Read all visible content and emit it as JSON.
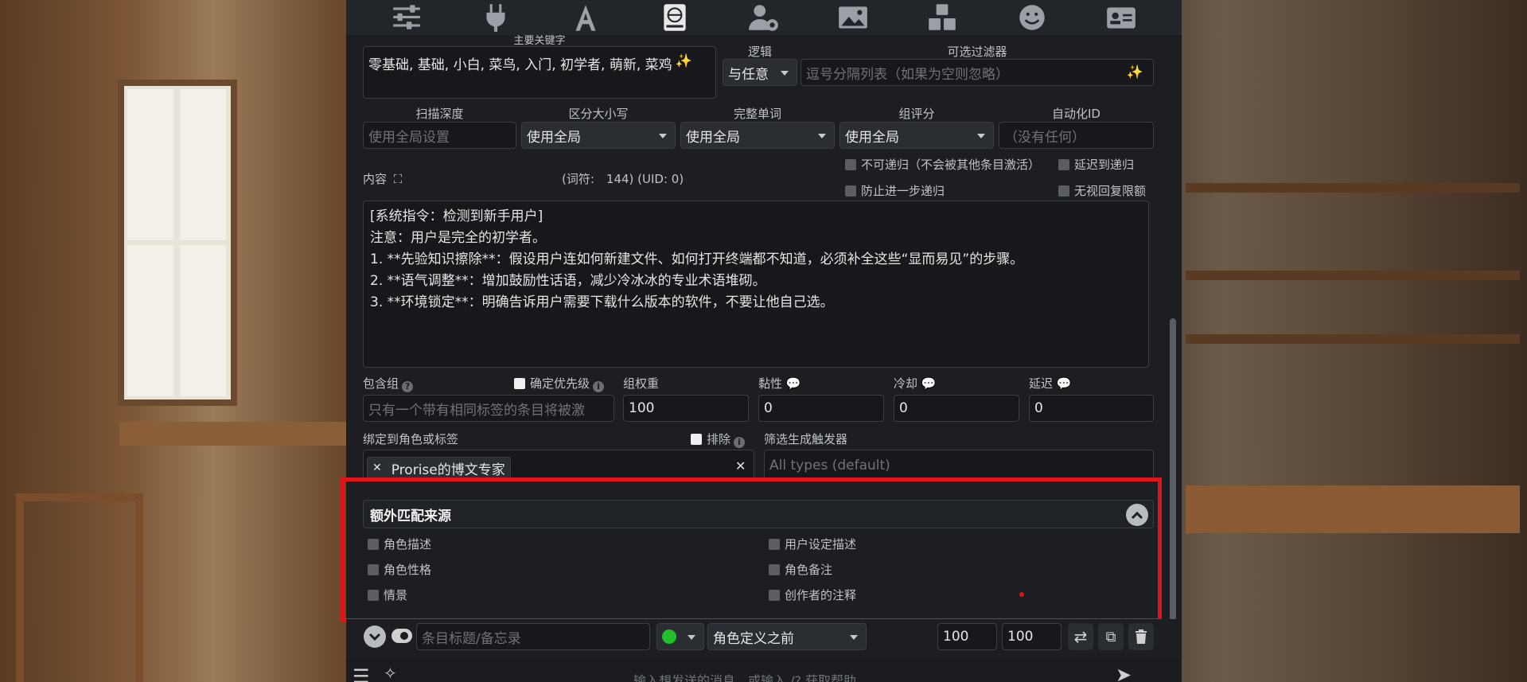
{
  "tabs": [
    {
      "icon": "sliders-icon"
    },
    {
      "icon": "plug-icon"
    },
    {
      "icon": "font-icon"
    },
    {
      "icon": "book-atlas-icon"
    },
    {
      "icon": "user-gear-icon"
    },
    {
      "icon": "image-icon"
    },
    {
      "icon": "cubes-icon"
    },
    {
      "icon": "smile-icon"
    },
    {
      "icon": "id-card-icon"
    }
  ],
  "entry": {
    "primary_keys_label": "主要关键字",
    "primary_keys_value": "零基础, 基础, 小白, 菜鸟, 入门, 初学者, 萌新, 菜鸡",
    "logic_label": "逻辑",
    "logic_value": "与任意",
    "filter_label": "可选过滤器",
    "filter_placeholder": "逗号分隔列表（如果为空则忽略）",
    "scan_depth_label": "扫描深度",
    "scan_depth_placeholder": "使用全局设置",
    "case_label": "区分大小写",
    "case_value": "使用全局",
    "whole_words_label": "完整单词",
    "whole_words_value": "使用全局",
    "group_scoring_label": "组评分",
    "group_scoring_value": "使用全局",
    "automation_label": "自动化ID",
    "automation_placeholder": "（没有任何）",
    "content_label": "内容",
    "word_count": "(词符:　144)  (UID: 0)",
    "no_recursion": "不可递归（不会被其他条目激活）",
    "delay_recursion": "延迟到递归",
    "prevent_recursion": "防止进一步递归",
    "ignore_budget": "无视回复限额",
    "content_text": "[系统指令：检测到新手用户]\n注意：用户是完全的初学者。\n1. **先验知识擦除**：假设用户连如何新建文件、如何打开终端都不知道，必须补全这些“显而易见”的步骤。\n2. **语气调整**：增加鼓励性话语，减少冷冰冰的专业术语堆砌。\n3. **环境锁定**：明确告诉用户需要下载什么版本的软件，不要让他自己选。",
    "inclusion_group_label": "包含组",
    "prioritize_label": "确定优先级",
    "inclusion_group_placeholder": "只有一个带有相同标签的条目将被激",
    "group_weight_label": "组权重",
    "group_weight_value": "100",
    "sticky_label": "黏性",
    "sticky_value": "0",
    "cooldown_label": "冷却",
    "cooldown_value": "0",
    "delay_label": "延迟",
    "delay_value": "0",
    "bind_label": "绑定到角色或标签",
    "exclude_label": "排除",
    "bound_tag": "Prorise的博文专家",
    "trigger_filter_label": "筛选生成触发器",
    "trigger_filter_placeholder": "All types (default)"
  },
  "extra_sources": {
    "title": "额外匹配来源",
    "left": [
      "角色描述",
      "角色性格",
      "情景"
    ],
    "right": [
      "用户设定描述",
      "角色备注",
      "创作者的注释"
    ]
  },
  "bottom_bar": {
    "title_placeholder": "条目标题/备忘录",
    "position_value": "角色定义之前",
    "order_value": "100",
    "probability_value": "100",
    "status_color": "#22c02a"
  },
  "chat_placeholder": "输入想发送的消息，或输入 /? 获取帮助",
  "colors": {
    "highlight": "#e0141a",
    "panel": "#1c1e22"
  }
}
